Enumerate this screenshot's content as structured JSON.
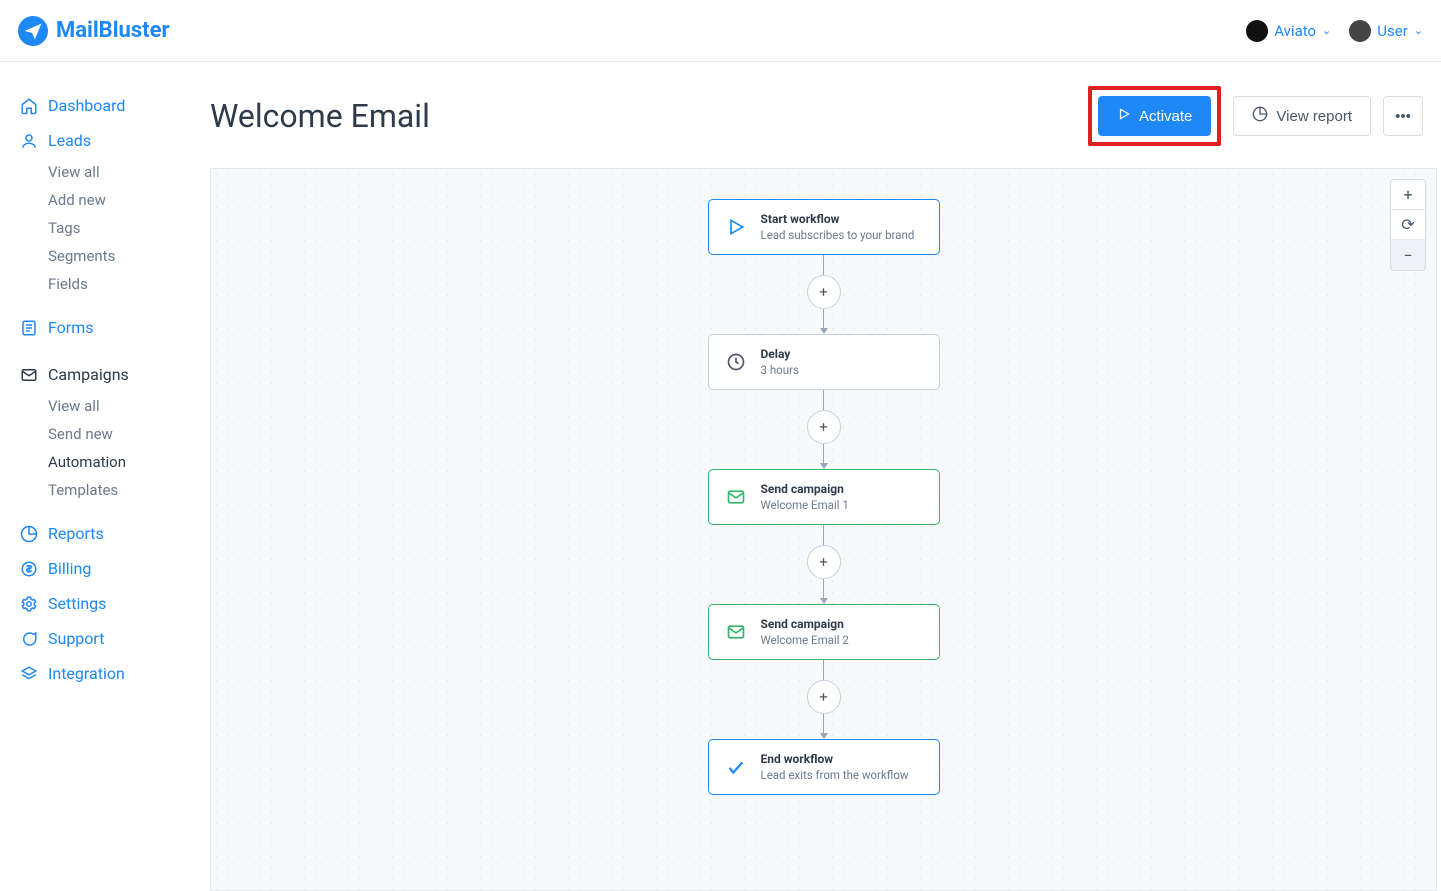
{
  "brand": {
    "name": "MailBluster"
  },
  "header": {
    "workspace": "Aviato",
    "user": "User"
  },
  "sidebar": {
    "dashboard": "Dashboard",
    "leads": {
      "label": "Leads",
      "items": [
        "View all",
        "Add new",
        "Tags",
        "Segments",
        "Fields"
      ]
    },
    "forms": "Forms",
    "campaigns": {
      "label": "Campaigns",
      "items": [
        "View all",
        "Send new",
        "Automation",
        "Templates"
      ]
    },
    "reports": "Reports",
    "billing": "Billing",
    "settings": "Settings",
    "support": "Support",
    "integration": "Integration"
  },
  "page": {
    "title": "Welcome Email",
    "activate": "Activate",
    "view_report": "View report"
  },
  "flow": {
    "nodes": [
      {
        "type": "start",
        "title": "Start workflow",
        "sub": "Lead subscribes to your brand"
      },
      {
        "type": "delay",
        "title": "Delay",
        "sub": "3 hours"
      },
      {
        "type": "campaign",
        "title": "Send campaign",
        "sub": "Welcome Email 1"
      },
      {
        "type": "campaign",
        "title": "Send campaign",
        "sub": "Welcome Email 2"
      },
      {
        "type": "end",
        "title": "End workflow",
        "sub": "Lead exits from the workflow"
      }
    ]
  }
}
